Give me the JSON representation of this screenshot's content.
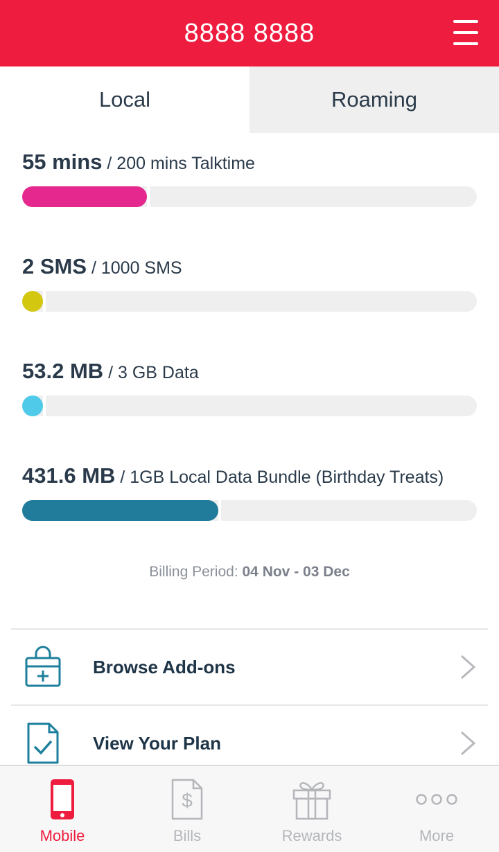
{
  "header": {
    "title": "8888 8888",
    "menu_icon": "hamburger-menu-icon"
  },
  "tabs": [
    {
      "label": "Local",
      "active": true
    },
    {
      "label": "Roaming",
      "active": false
    }
  ],
  "usage": [
    {
      "used": "55 mins",
      "total": "/ 200 mins Talktime",
      "fraction": 0.275,
      "color": "#e5288e"
    },
    {
      "used": "2 SMS",
      "total": "/ 1000 SMS",
      "fraction": 0.002,
      "color": "#d4c70f"
    },
    {
      "used": "53.2 MB",
      "total": "/ 3 GB Data",
      "fraction": 0.017,
      "color": "#4fcbe9"
    },
    {
      "used": "431.6 MB",
      "total": "/ 1GB Local Data Bundle (Birthday Treats)",
      "fraction": 0.4316,
      "color": "#207c9a"
    }
  ],
  "billing": {
    "label": "Billing Period:",
    "dates": "04 Nov - 03 Dec"
  },
  "actions": [
    {
      "label": "Browse Add-ons",
      "icon": "shopping-bag-plus-icon"
    },
    {
      "label": "View Your Plan",
      "icon": "document-check-icon"
    }
  ],
  "nav": [
    {
      "label": "Mobile",
      "icon": "mobile-phone-icon",
      "active": true
    },
    {
      "label": "Bills",
      "icon": "bill-dollar-icon",
      "active": false
    },
    {
      "label": "Rewards",
      "icon": "gift-icon",
      "active": false
    },
    {
      "label": "More",
      "icon": "more-dots-icon",
      "active": false
    }
  ],
  "colors": {
    "brand": "#ee1c3e",
    "icon_teal": "#1c7f9c",
    "inactive": "#b4b6ba"
  }
}
